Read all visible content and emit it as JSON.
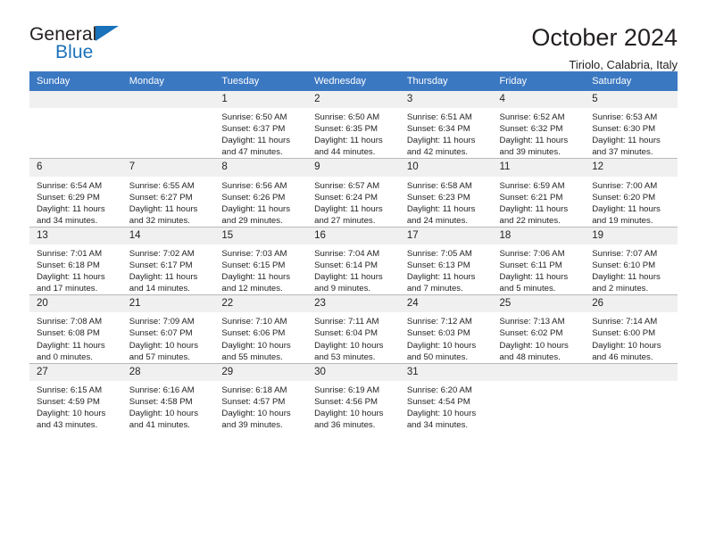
{
  "brand": {
    "name_dark": "General",
    "name_blue": "Blue",
    "triangle_icon": "triangle-icon",
    "accent_color": "#1a72ba"
  },
  "header": {
    "title": "October 2024",
    "location": "Tiriolo, Calabria, Italy"
  },
  "calendar": {
    "header_color": "#3b78c2",
    "daynum_bg": "#f0f0f0",
    "weekdays": [
      "Sunday",
      "Monday",
      "Tuesday",
      "Wednesday",
      "Thursday",
      "Friday",
      "Saturday"
    ],
    "weeks": [
      [
        {
          "day": "",
          "sunrise": "",
          "sunset": "",
          "daylight1": "",
          "daylight2": ""
        },
        {
          "day": "",
          "sunrise": "",
          "sunset": "",
          "daylight1": "",
          "daylight2": ""
        },
        {
          "day": "1",
          "sunrise": "Sunrise: 6:50 AM",
          "sunset": "Sunset: 6:37 PM",
          "daylight1": "Daylight: 11 hours",
          "daylight2": "and 47 minutes."
        },
        {
          "day": "2",
          "sunrise": "Sunrise: 6:50 AM",
          "sunset": "Sunset: 6:35 PM",
          "daylight1": "Daylight: 11 hours",
          "daylight2": "and 44 minutes."
        },
        {
          "day": "3",
          "sunrise": "Sunrise: 6:51 AM",
          "sunset": "Sunset: 6:34 PM",
          "daylight1": "Daylight: 11 hours",
          "daylight2": "and 42 minutes."
        },
        {
          "day": "4",
          "sunrise": "Sunrise: 6:52 AM",
          "sunset": "Sunset: 6:32 PM",
          "daylight1": "Daylight: 11 hours",
          "daylight2": "and 39 minutes."
        },
        {
          "day": "5",
          "sunrise": "Sunrise: 6:53 AM",
          "sunset": "Sunset: 6:30 PM",
          "daylight1": "Daylight: 11 hours",
          "daylight2": "and 37 minutes."
        }
      ],
      [
        {
          "day": "6",
          "sunrise": "Sunrise: 6:54 AM",
          "sunset": "Sunset: 6:29 PM",
          "daylight1": "Daylight: 11 hours",
          "daylight2": "and 34 minutes."
        },
        {
          "day": "7",
          "sunrise": "Sunrise: 6:55 AM",
          "sunset": "Sunset: 6:27 PM",
          "daylight1": "Daylight: 11 hours",
          "daylight2": "and 32 minutes."
        },
        {
          "day": "8",
          "sunrise": "Sunrise: 6:56 AM",
          "sunset": "Sunset: 6:26 PM",
          "daylight1": "Daylight: 11 hours",
          "daylight2": "and 29 minutes."
        },
        {
          "day": "9",
          "sunrise": "Sunrise: 6:57 AM",
          "sunset": "Sunset: 6:24 PM",
          "daylight1": "Daylight: 11 hours",
          "daylight2": "and 27 minutes."
        },
        {
          "day": "10",
          "sunrise": "Sunrise: 6:58 AM",
          "sunset": "Sunset: 6:23 PM",
          "daylight1": "Daylight: 11 hours",
          "daylight2": "and 24 minutes."
        },
        {
          "day": "11",
          "sunrise": "Sunrise: 6:59 AM",
          "sunset": "Sunset: 6:21 PM",
          "daylight1": "Daylight: 11 hours",
          "daylight2": "and 22 minutes."
        },
        {
          "day": "12",
          "sunrise": "Sunrise: 7:00 AM",
          "sunset": "Sunset: 6:20 PM",
          "daylight1": "Daylight: 11 hours",
          "daylight2": "and 19 minutes."
        }
      ],
      [
        {
          "day": "13",
          "sunrise": "Sunrise: 7:01 AM",
          "sunset": "Sunset: 6:18 PM",
          "daylight1": "Daylight: 11 hours",
          "daylight2": "and 17 minutes."
        },
        {
          "day": "14",
          "sunrise": "Sunrise: 7:02 AM",
          "sunset": "Sunset: 6:17 PM",
          "daylight1": "Daylight: 11 hours",
          "daylight2": "and 14 minutes."
        },
        {
          "day": "15",
          "sunrise": "Sunrise: 7:03 AM",
          "sunset": "Sunset: 6:15 PM",
          "daylight1": "Daylight: 11 hours",
          "daylight2": "and 12 minutes."
        },
        {
          "day": "16",
          "sunrise": "Sunrise: 7:04 AM",
          "sunset": "Sunset: 6:14 PM",
          "daylight1": "Daylight: 11 hours",
          "daylight2": "and 9 minutes."
        },
        {
          "day": "17",
          "sunrise": "Sunrise: 7:05 AM",
          "sunset": "Sunset: 6:13 PM",
          "daylight1": "Daylight: 11 hours",
          "daylight2": "and 7 minutes."
        },
        {
          "day": "18",
          "sunrise": "Sunrise: 7:06 AM",
          "sunset": "Sunset: 6:11 PM",
          "daylight1": "Daylight: 11 hours",
          "daylight2": "and 5 minutes."
        },
        {
          "day": "19",
          "sunrise": "Sunrise: 7:07 AM",
          "sunset": "Sunset: 6:10 PM",
          "daylight1": "Daylight: 11 hours",
          "daylight2": "and 2 minutes."
        }
      ],
      [
        {
          "day": "20",
          "sunrise": "Sunrise: 7:08 AM",
          "sunset": "Sunset: 6:08 PM",
          "daylight1": "Daylight: 11 hours",
          "daylight2": "and 0 minutes."
        },
        {
          "day": "21",
          "sunrise": "Sunrise: 7:09 AM",
          "sunset": "Sunset: 6:07 PM",
          "daylight1": "Daylight: 10 hours",
          "daylight2": "and 57 minutes."
        },
        {
          "day": "22",
          "sunrise": "Sunrise: 7:10 AM",
          "sunset": "Sunset: 6:06 PM",
          "daylight1": "Daylight: 10 hours",
          "daylight2": "and 55 minutes."
        },
        {
          "day": "23",
          "sunrise": "Sunrise: 7:11 AM",
          "sunset": "Sunset: 6:04 PM",
          "daylight1": "Daylight: 10 hours",
          "daylight2": "and 53 minutes."
        },
        {
          "day": "24",
          "sunrise": "Sunrise: 7:12 AM",
          "sunset": "Sunset: 6:03 PM",
          "daylight1": "Daylight: 10 hours",
          "daylight2": "and 50 minutes."
        },
        {
          "day": "25",
          "sunrise": "Sunrise: 7:13 AM",
          "sunset": "Sunset: 6:02 PM",
          "daylight1": "Daylight: 10 hours",
          "daylight2": "and 48 minutes."
        },
        {
          "day": "26",
          "sunrise": "Sunrise: 7:14 AM",
          "sunset": "Sunset: 6:00 PM",
          "daylight1": "Daylight: 10 hours",
          "daylight2": "and 46 minutes."
        }
      ],
      [
        {
          "day": "27",
          "sunrise": "Sunrise: 6:15 AM",
          "sunset": "Sunset: 4:59 PM",
          "daylight1": "Daylight: 10 hours",
          "daylight2": "and 43 minutes."
        },
        {
          "day": "28",
          "sunrise": "Sunrise: 6:16 AM",
          "sunset": "Sunset: 4:58 PM",
          "daylight1": "Daylight: 10 hours",
          "daylight2": "and 41 minutes."
        },
        {
          "day": "29",
          "sunrise": "Sunrise: 6:18 AM",
          "sunset": "Sunset: 4:57 PM",
          "daylight1": "Daylight: 10 hours",
          "daylight2": "and 39 minutes."
        },
        {
          "day": "30",
          "sunrise": "Sunrise: 6:19 AM",
          "sunset": "Sunset: 4:56 PM",
          "daylight1": "Daylight: 10 hours",
          "daylight2": "and 36 minutes."
        },
        {
          "day": "31",
          "sunrise": "Sunrise: 6:20 AM",
          "sunset": "Sunset: 4:54 PM",
          "daylight1": "Daylight: 10 hours",
          "daylight2": "and 34 minutes."
        },
        {
          "day": "",
          "sunrise": "",
          "sunset": "",
          "daylight1": "",
          "daylight2": ""
        },
        {
          "day": "",
          "sunrise": "",
          "sunset": "",
          "daylight1": "",
          "daylight2": ""
        }
      ]
    ]
  }
}
